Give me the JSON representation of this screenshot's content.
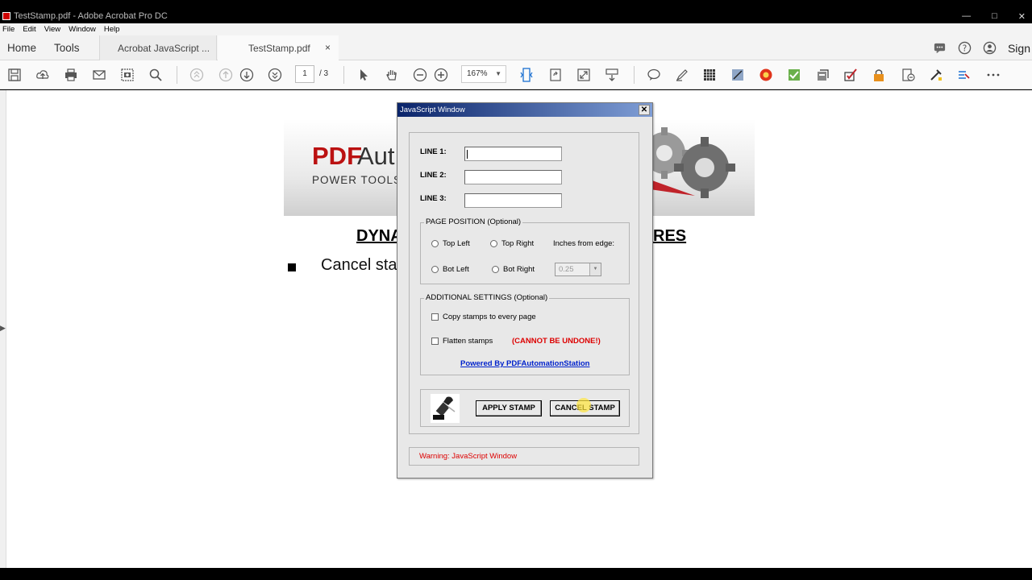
{
  "window": {
    "title": "TestStamp.pdf - Adobe Acrobat Pro DC",
    "controls": [
      "—",
      "□",
      "✕"
    ]
  },
  "menu": [
    "File",
    "Edit",
    "View",
    "Window",
    "Help"
  ],
  "tabs": {
    "home": "Home",
    "tools": "Tools",
    "documents": [
      {
        "label": "Acrobat JavaScript ..."
      },
      {
        "label": "TestStamp.pdf",
        "close": "×"
      }
    ],
    "sign": "Sign"
  },
  "toolbar": {
    "icons": [
      "save-icon",
      "upload-icon",
      "print-icon",
      "email-icon",
      "screenshot-icon",
      "search-icon",
      "first-page-icon",
      "previous-page-icon",
      "next-page-icon",
      "last-page-icon",
      "select-arrow-icon",
      "hand-tool-icon",
      "zoom-out-icon",
      "zoom-in-icon",
      "fit-page-icon",
      "rotate-icon",
      "full-screen-icon",
      "scroll-mode-icon",
      "comment-icon",
      "highlight-pen-icon",
      "grid-icon",
      "edit-icon",
      "stamp-red-icon",
      "check-green-icon",
      "form-icon",
      "sign-icon",
      "lock-icon",
      "export-icon",
      "tools-icon",
      "redact-icon",
      "more-icon"
    ],
    "page_current": "1",
    "page_total": "/ 3",
    "zoom": "167%"
  },
  "document": {
    "logo_pdf": "PDF",
    "logo_rest": "Aut",
    "tagline": "POWER TOOLS",
    "heading_left": "DYNA",
    "heading_right": "RES",
    "bullet_text": "Cancel sta"
  },
  "dialog": {
    "title": "JavaScript Window",
    "close": "✕",
    "line1_label": "LINE 1:",
    "line2_label": "LINE 2:",
    "line3_label": "LINE 3:",
    "line1_value": "",
    "line2_value": "",
    "line3_value": "",
    "page_position": {
      "title": "PAGE POSITION (Optional)",
      "top_left": "Top Left",
      "top_right": "Top Right",
      "bot_left": "Bot Left",
      "bot_right": "Bot Right",
      "inches_label": "Inches from edge:",
      "inches_value": "0.25"
    },
    "additional": {
      "title": "ADDITIONAL SETTINGS (Optional)",
      "copy_label": "Copy stamps to every page",
      "flatten_label": "Flatten stamps",
      "flatten_warning": "(CANNOT BE UNDONE!)",
      "powered_by": "Powered By PDFAutomationStation"
    },
    "apply_button": "APPLY STAMP",
    "cancel_button": "CANCEL STAMP",
    "status": "Warning: JavaScript Window"
  }
}
